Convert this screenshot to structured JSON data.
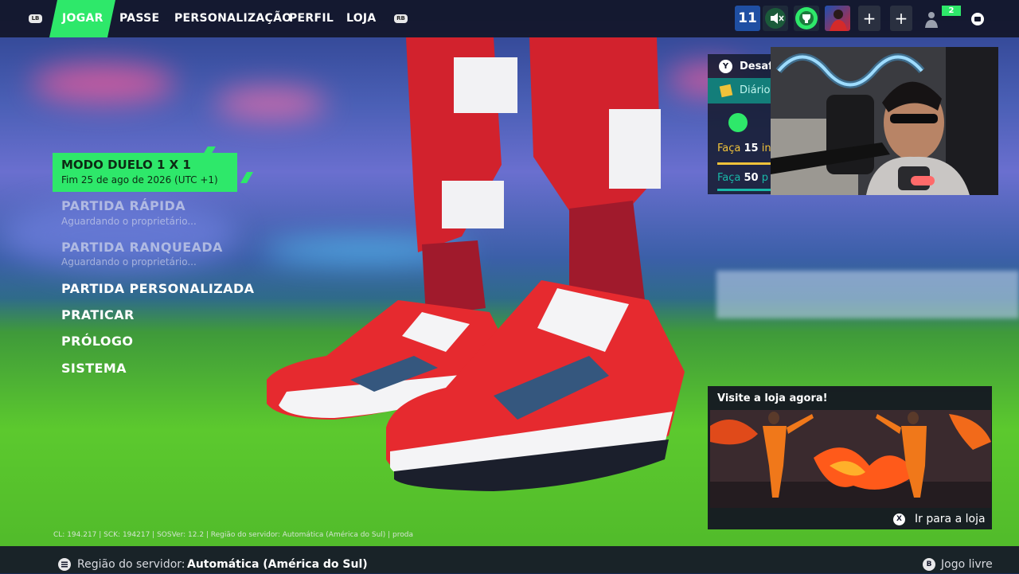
{
  "nav": {
    "lb": "LB",
    "rb": "RB",
    "tabs": [
      {
        "label": "JOGAR",
        "active": true
      },
      {
        "label": "PASSE"
      },
      {
        "label": "PERSONALIZAÇÃO"
      },
      {
        "label": "PERFIL"
      },
      {
        "label": "LOJA"
      }
    ]
  },
  "hud": {
    "level": "11",
    "friends_count": "2",
    "icons": [
      "mute-icon",
      "trophy-icon",
      "avatar-icon",
      "plus-icon",
      "plus-icon",
      "person-icon",
      "chat-icon"
    ]
  },
  "menu": {
    "selected": {
      "title": "MODO DUELO 1 X 1",
      "subtitle": "Fim 25 de ago de 2026 (UTC +1)"
    },
    "items": [
      {
        "label": "PARTIDA RÁPIDA",
        "sub": "Aguardando o proprietário...",
        "dim": true
      },
      {
        "label": "PARTIDA RANQUEADA",
        "sub": "Aguardando o proprietário...",
        "dim": true
      },
      {
        "label": "PARTIDA PERSONALIZADA"
      },
      {
        "label": "PRATICAR"
      },
      {
        "label": "PRÓLOGO"
      },
      {
        "label": "SISTEMA"
      }
    ]
  },
  "challenges": {
    "button": "Y",
    "title": "Desafi",
    "daily": "Diário",
    "task1_prefix": "Faça ",
    "task1_num": "15",
    "task1_suffix": " in",
    "task2_prefix": "Faça ",
    "task2_num": "50",
    "task2_suffix": " p"
  },
  "store_promo": {
    "title": "Visite a loja agora!",
    "button": "X",
    "action": "Ir para a loja"
  },
  "version_info": "CL: 194.217 | SCK: 194217 | SOSVer: 12.2 | Região do servidor: Automática (América do Sul) | proda",
  "bottom": {
    "region_label": "Região do servidor:",
    "region_value": "Automática (América do Sul)",
    "b_button": "B",
    "free_play": "Jogo livre"
  },
  "colors": {
    "accent": "#2ee86a",
    "topbar": "#12162a",
    "teal": "#18b8a8"
  }
}
